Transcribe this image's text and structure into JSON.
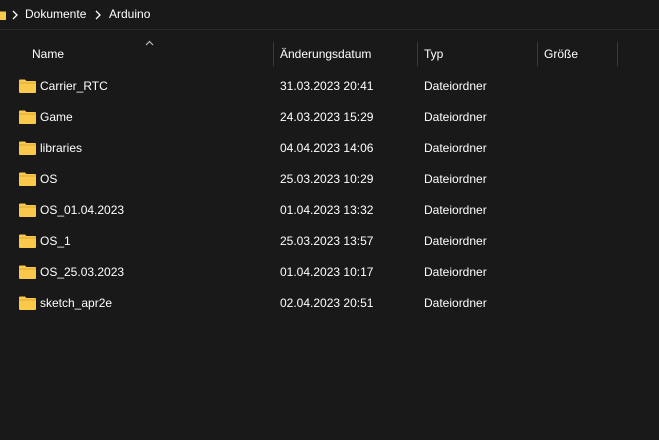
{
  "breadcrumb": {
    "items": [
      {
        "label": "Dokumente"
      },
      {
        "label": "Arduino"
      }
    ]
  },
  "columns": {
    "name": "Name",
    "date": "Änderungsdatum",
    "type": "Typ",
    "size": "Größe",
    "sort_column": "name",
    "sort_direction": "ascending"
  },
  "colors": {
    "background": "#191919",
    "text": "#ffffff",
    "folder": "#f8c94a",
    "separator": "#3a3a3a"
  },
  "files": [
    {
      "name": "Carrier_RTC",
      "date": "31.03.2023 20:41",
      "type": "Dateiordner",
      "size": "",
      "icon": "folder-icon"
    },
    {
      "name": "Game",
      "date": "24.03.2023 15:29",
      "type": "Dateiordner",
      "size": "",
      "icon": "folder-icon"
    },
    {
      "name": "libraries",
      "date": "04.04.2023 14:06",
      "type": "Dateiordner",
      "size": "",
      "icon": "folder-icon"
    },
    {
      "name": "OS",
      "date": "25.03.2023 10:29",
      "type": "Dateiordner",
      "size": "",
      "icon": "folder-icon"
    },
    {
      "name": "OS_01.04.2023",
      "date": "01.04.2023 13:32",
      "type": "Dateiordner",
      "size": "",
      "icon": "folder-icon"
    },
    {
      "name": "OS_1",
      "date": "25.03.2023 13:57",
      "type": "Dateiordner",
      "size": "",
      "icon": "folder-icon"
    },
    {
      "name": "OS_25.03.2023",
      "date": "01.04.2023 10:17",
      "type": "Dateiordner",
      "size": "",
      "icon": "folder-icon"
    },
    {
      "name": "sketch_apr2e",
      "date": "02.04.2023 20:51",
      "type": "Dateiordner",
      "size": "",
      "icon": "folder-icon"
    }
  ]
}
